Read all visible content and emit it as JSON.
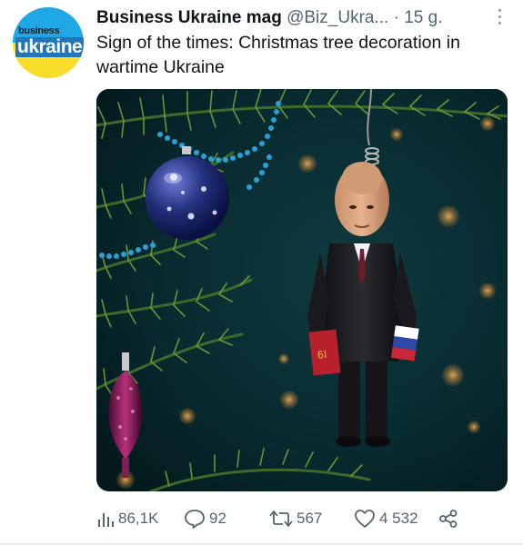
{
  "account": {
    "avatar_text_top": "business",
    "avatar_text_main": "ukraine",
    "display_name": "Business Ukraine mag",
    "handle": "@Biz_Ukra...",
    "separator": "·",
    "timestamp": "15 g."
  },
  "tweet": {
    "text": "Sign of the times: Christmas tree decoration in wartime Ukraine"
  },
  "media": {
    "book_label": "6I"
  },
  "actions": {
    "views": "86,1K",
    "replies": "92",
    "retweets": "567",
    "likes": "4 532"
  },
  "icons": {
    "views": "analytics-bar-icon",
    "reply": "speech-bubble-icon",
    "retweet": "retweet-arrows-icon",
    "like": "heart-icon",
    "share": "share-nodes-icon",
    "more": "vertical-dots-icon"
  },
  "colors": {
    "avatar_blue": "#1fa7e6",
    "avatar_yellow": "#f7dd2a",
    "secondary_text": "#536471",
    "primary_text": "#0f1419"
  }
}
